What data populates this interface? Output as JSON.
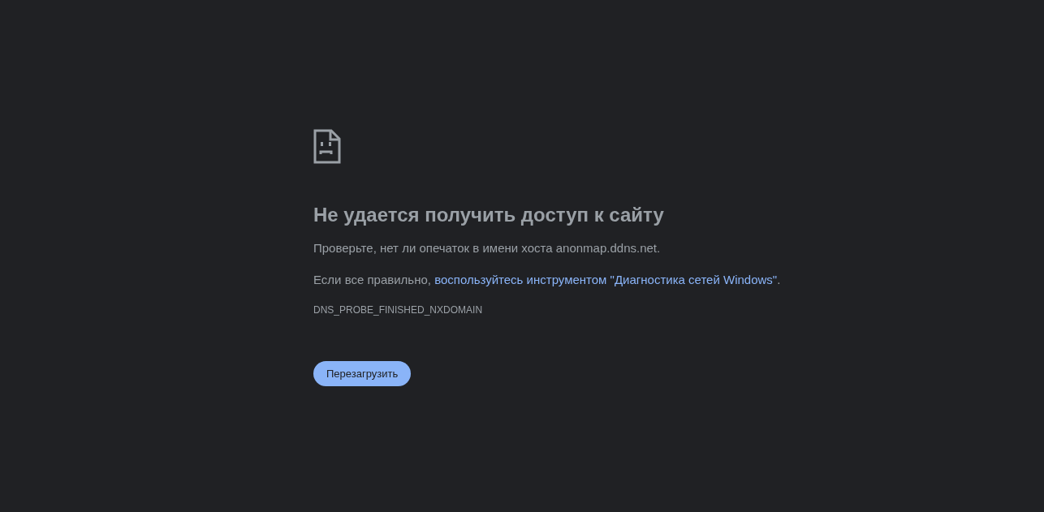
{
  "heading": "Не удается получить доступ к сайту",
  "hint": "Проверьте, нет ли опечаток в имени хоста anonmap.ddns.net.",
  "suggestion": {
    "prefix": "Если все правильно, ",
    "link": "воспользуйтесь инструментом \"Диагностика сетей Windows\"",
    "suffix": "."
  },
  "error_code": "DNS_PROBE_FINISHED_NXDOMAIN",
  "buttons": [
    "Перезагрузить"
  ]
}
